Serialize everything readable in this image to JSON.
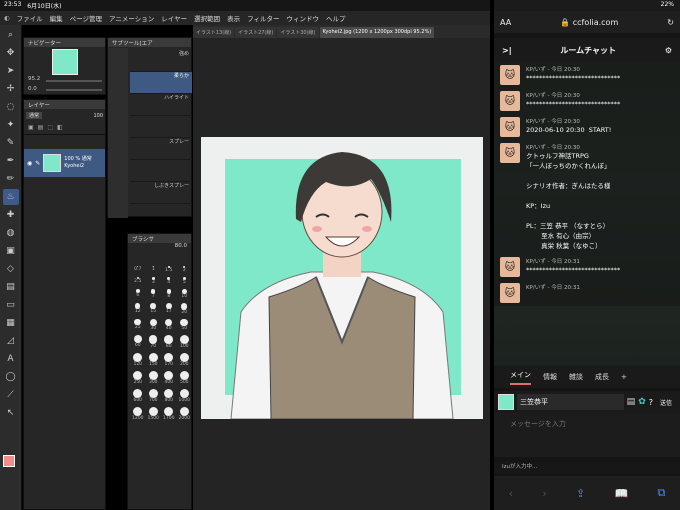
{
  "status_left": {
    "time": "23:53",
    "date": "6月10日(水)"
  },
  "status_right": {
    "battery": "22%"
  },
  "menu": [
    "ファイル",
    "編集",
    "ページ管理",
    "アニメーション",
    "レイヤー",
    "選択範囲",
    "表示",
    "フィルター",
    "ウィンドウ",
    "ヘルプ"
  ],
  "navigator": {
    "title": "ナビゲーター",
    "zoom": "95.2",
    "rotate": "0.0"
  },
  "subtool": {
    "title": "サブツール[エア",
    "brushes": [
      "強め",
      "柔らか",
      "ハイライト",
      "",
      "スプレー",
      "",
      "しぶきスプレー"
    ],
    "selected": "柔らか"
  },
  "brushsize": {
    "title": "ブラシサ",
    "value": "80.0",
    "sizes": [
      "0.7",
      "1",
      "1.5",
      "2",
      "2.5",
      "3",
      "4",
      "5",
      "6",
      "7",
      "8",
      "10",
      "12",
      "15",
      "17",
      "20",
      "25",
      "30",
      "40",
      "50",
      "60",
      "70",
      "80",
      "100",
      "120",
      "150",
      "170",
      "200",
      "250",
      "300",
      "400",
      "500",
      "600",
      "700",
      "800",
      "1000",
      "1200",
      "1500",
      "1700",
      "2000"
    ]
  },
  "layer": {
    "title": "レイヤー",
    "blend": "通常",
    "opacity": "100",
    "item_opacity": "100 %",
    "item_mode": "通常",
    "item_name": "Kyohei2"
  },
  "tabs": [
    "イラスト13(線)",
    "イラスト27(線)",
    "イラスト30(線)",
    "Kyohei2.jpg (1200 x 1200px 300dpi 95.2%)"
  ],
  "safari": {
    "aa": "AA",
    "url": "ccfolia.com",
    "room_title": "ルームチャット"
  },
  "messages": [
    {
      "name": "KP/いず",
      "time": "- 今日 20:30",
      "text": "*****************************"
    },
    {
      "name": "KP/いず",
      "time": "- 今日 20:30",
      "text": "*****************************"
    },
    {
      "name": "KP/いず",
      "time": "- 今日 20:30",
      "text": "2020-06-10 20:30  START!"
    },
    {
      "name": "KP/いず",
      "time": "- 今日 20:30",
      "text": "クトゥルフ神話TRPG\n「一人ぼっちのかくれんぼ」\n\nシナリオ作者：ぎんはたる様\n\nKP：Izu\n\nPL：三笠 恭平 （なすとら）\n　　 至水 有心（由宗）\n　　 真栄 秋葉（なゆこ）"
    },
    {
      "name": "KP/いず",
      "time": "- 今日 20:31",
      "text": "*****************************"
    },
    {
      "name": "KP/いず",
      "time": "- 今日 20:31",
      "text": ""
    }
  ],
  "chat_tabs": [
    "メイン",
    "情報",
    "雑談",
    "成長",
    "+"
  ],
  "character": {
    "name": "三笠恭平",
    "send": "送信"
  },
  "input": {
    "placeholder": "メッセージを入力"
  },
  "typing": "Izuが入力中..."
}
